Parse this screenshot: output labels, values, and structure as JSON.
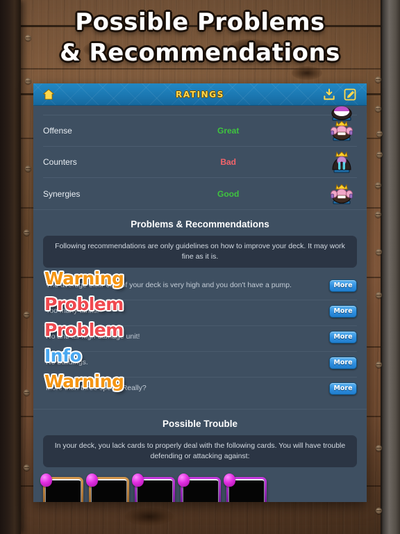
{
  "page": {
    "title_line1": "Possible Problems",
    "title_line2": "& Recommendations"
  },
  "title_bar": {
    "label": "RATINGS",
    "home_icon": "home-icon",
    "download_icon": "download-icon",
    "edit_icon": "edit-icon"
  },
  "ratings": {
    "rows": [
      {
        "name": "",
        "value": "",
        "emote": "king-thumbs-up-emote"
      },
      {
        "name": "Offense",
        "value": "Great",
        "tone": "great",
        "emote": "king-thumbs-up-emote"
      },
      {
        "name": "Counters",
        "value": "Bad",
        "tone": "bad",
        "emote": "king-crying-emote"
      },
      {
        "name": "Synergies",
        "value": "Good",
        "tone": "good",
        "emote": "king-thumbs-up-emote"
      }
    ]
  },
  "problems_section": {
    "heading": "Problems & Recommendations",
    "disclaimer": "Following recommendations are only guidelines on how to improve your deck. It may work fine as it is.",
    "more_label": "More",
    "items": [
      {
        "label": "Warning",
        "severity": "warning",
        "description": "The average elixir cost of your deck is very high and you don't have a pump."
      },
      {
        "label": "Problem",
        "severity": "problem",
        "description": "Too many tanks!"
      },
      {
        "label": "Problem",
        "severity": "problem",
        "description": "No anti-air high-damage unit!"
      },
      {
        "label": "Info",
        "severity": "info",
        "description": "No buildings."
      },
      {
        "label": "Warning",
        "severity": "warning",
        "description": "More than three spells. Really?"
      }
    ]
  },
  "trouble_section": {
    "heading": "Possible Trouble",
    "description": "In your deck, you lack cards to properly deal with the following cards. You will have trouble defending or attacking against:",
    "cards": [
      {
        "rarity": "legendary-gold",
        "elixir_gem": true
      },
      {
        "rarity": "legendary-gold",
        "elixir_gem": true
      },
      {
        "rarity": "epic-purple",
        "elixir_gem": true
      },
      {
        "rarity": "epic-purple",
        "elixir_gem": true
      },
      {
        "rarity": "epic-purple",
        "elixir_gem": true
      }
    ]
  },
  "colors": {
    "panel": "#3e4f61",
    "title_bar": "#1d7ab5",
    "accent_gold": "#ffd84d",
    "good": "#3fc43f",
    "bad": "#f4646a",
    "warning": "#f59512",
    "problem": "#f0494f",
    "info": "#4aa8f0"
  }
}
